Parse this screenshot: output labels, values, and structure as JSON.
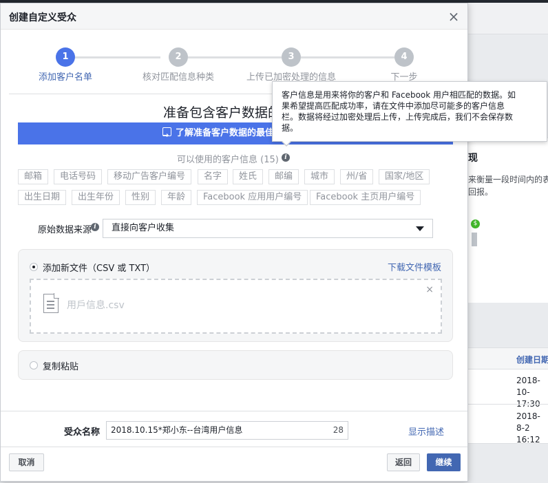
{
  "background": {
    "panel_title": "现",
    "panel_text_line1": "来衡量一段时间内的表",
    "panel_text_line2": "回报。",
    "dollar_icon": "dollar-icon",
    "table_header": "创建日期",
    "row1_date": "2018-10-",
    "row1_time": "17:30",
    "row2_date": "2018-8-2",
    "row2_time": "16:12"
  },
  "dialog": {
    "title": "创建自定义受众",
    "close_icon": "close-icon"
  },
  "steps": [
    {
      "number": "1",
      "label": "添加客户名单",
      "active": true
    },
    {
      "number": "2",
      "label": "核对匹配信息种类",
      "active": false
    },
    {
      "number": "3",
      "label": "上传已加密处理的信息",
      "active": false
    },
    {
      "number": "4",
      "label": "下一步",
      "active": false
    }
  ],
  "prepare": {
    "title": "准备包含客户数据的",
    "learn_button": "了解准备客户数据的最佳"
  },
  "available": {
    "label": "可以使用的客户信息 (15)",
    "tags": [
      "邮箱",
      "电话号码",
      "移动广告客户编号",
      "名字",
      "姓氏",
      "邮编",
      "城市",
      "州/省",
      "国家/地区",
      "出生日期",
      "出生年份",
      "性别",
      "年龄",
      "Facebook 应用用户编号",
      "Facebook 主页用户编号"
    ]
  },
  "source": {
    "label": "原始数据来源",
    "selected": "直接向客户收集"
  },
  "upload": {
    "option_label": "添加新文件（CSV 或 TXT）",
    "template_link": "下载文件模板",
    "file_name": "用戶信息.csv",
    "remove": "×"
  },
  "paste": {
    "option_label": "复制粘贴"
  },
  "footer": {
    "name_label": "受众名称",
    "name_value": "2018.10.15*郑小东--台湾用户信息",
    "name_count": "28",
    "desc_link": "显示描述",
    "cancel": "取消",
    "back": "返回",
    "next": "继续"
  },
  "tooltip": {
    "line1": "客户信息是用来将你的客户和 Facebook 用户相匹配的数据。如",
    "line2": "果希望提高匹配成功率，请在文件中添加尽可能多的客户信息",
    "line3": "栏。数据将经过加密处理后上传，上传完成后，我们不会保存数",
    "line4": "据。"
  },
  "colors": {
    "accent": "#4a73e8",
    "link": "#4267b2",
    "primary_button": "#4267b2"
  }
}
